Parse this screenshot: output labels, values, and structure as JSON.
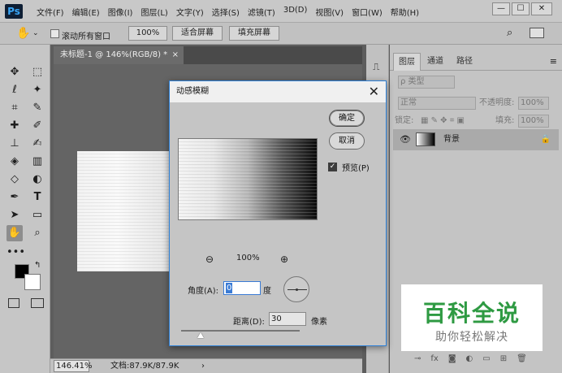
{
  "app": {
    "logo": "Ps",
    "menu": [
      "文件(F)",
      "编辑(E)",
      "图像(I)",
      "图层(L)",
      "文字(Y)",
      "选择(S)",
      "滤镜(T)",
      "3D(D)",
      "视图(V)",
      "窗口(W)",
      "帮助(H)"
    ],
    "window_controls": {
      "minimize": "—",
      "maximize": "☐",
      "close": "✕"
    }
  },
  "options": {
    "scroll_all_label": "滚动所有窗口",
    "zoom_100": "100%",
    "fit_screen": "适合屏幕",
    "fill_screen": "填充屏幕"
  },
  "document": {
    "tab_title": "未标题-1 @ 146%(RGB/8) *",
    "tab_close": "×",
    "zoom_readout": "146.41%",
    "doc_info": "文档:87.9K/87.9K",
    "status_arrow": "›"
  },
  "layers_panel": {
    "tabs": [
      "图层",
      "通道",
      "路径"
    ],
    "filter_kind": "ρ 类型",
    "blend_mode": "正常",
    "opacity_label": "不透明度:",
    "opacity_value": "100%",
    "lock_label": "锁定:",
    "fill_label": "填充:",
    "fill_value": "100%",
    "layer_name": "背景"
  },
  "dialog": {
    "title": "动感模糊",
    "close": "✕",
    "ok": "确定",
    "cancel": "取消",
    "preview_label": "预览(P)",
    "preview_checked": true,
    "zoom_level": "100%",
    "zoom_out": "⊖",
    "zoom_in": "⊕",
    "angle_label": "角度(A):",
    "angle_value": "0",
    "angle_unit": "度",
    "distance_label": "距离(D):",
    "distance_value": "30",
    "distance_unit": "像素"
  },
  "watermark": {
    "line1": "百科全说",
    "line2": "助你轻松解决"
  },
  "tools": [
    "hand-tool",
    "zoom-tool"
  ]
}
